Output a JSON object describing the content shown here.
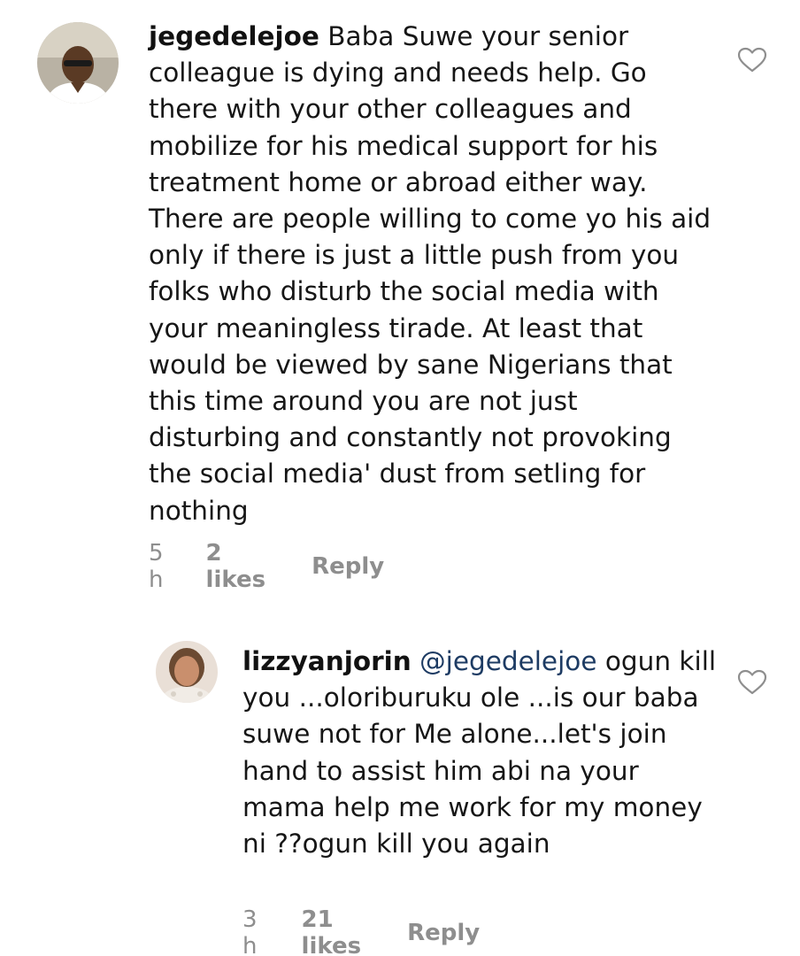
{
  "comments": [
    {
      "username": "jegedelejoe",
      "text": "Baba Suwe your senior colleague is dying and needs help. Go there with your other colleagues and mobilize for his medical support for his treatment home or abroad either way. There are people willing to come yo his aid only if there is just a little push from you folks who disturb the social media with your meaningless tirade. At least that would be viewed by sane Nigerians that this time around you are not just disturbing and constantly not provoking the social media' dust from setling for nothing",
      "time": "5 h",
      "likes": "2 likes",
      "reply_label": "Reply",
      "like_icon": "heart-outline-icon"
    },
    {
      "username": "lizzyanjorin",
      "mention": "@jegedelejoe",
      "text": "ogun kill you ...oloriburuku ole ...is our baba suwe not for Me alone...let's join hand to assist him abi na your mama help me work for my money ni ??ogun kill you again",
      "time": "3 h",
      "likes": "21 likes",
      "reply_label": "Reply",
      "like_icon": "heart-outline-icon"
    }
  ],
  "colors": {
    "text": "#161616",
    "meta": "#8e8e8e",
    "mention": "#1d3b63",
    "background": "#ffffff"
  }
}
